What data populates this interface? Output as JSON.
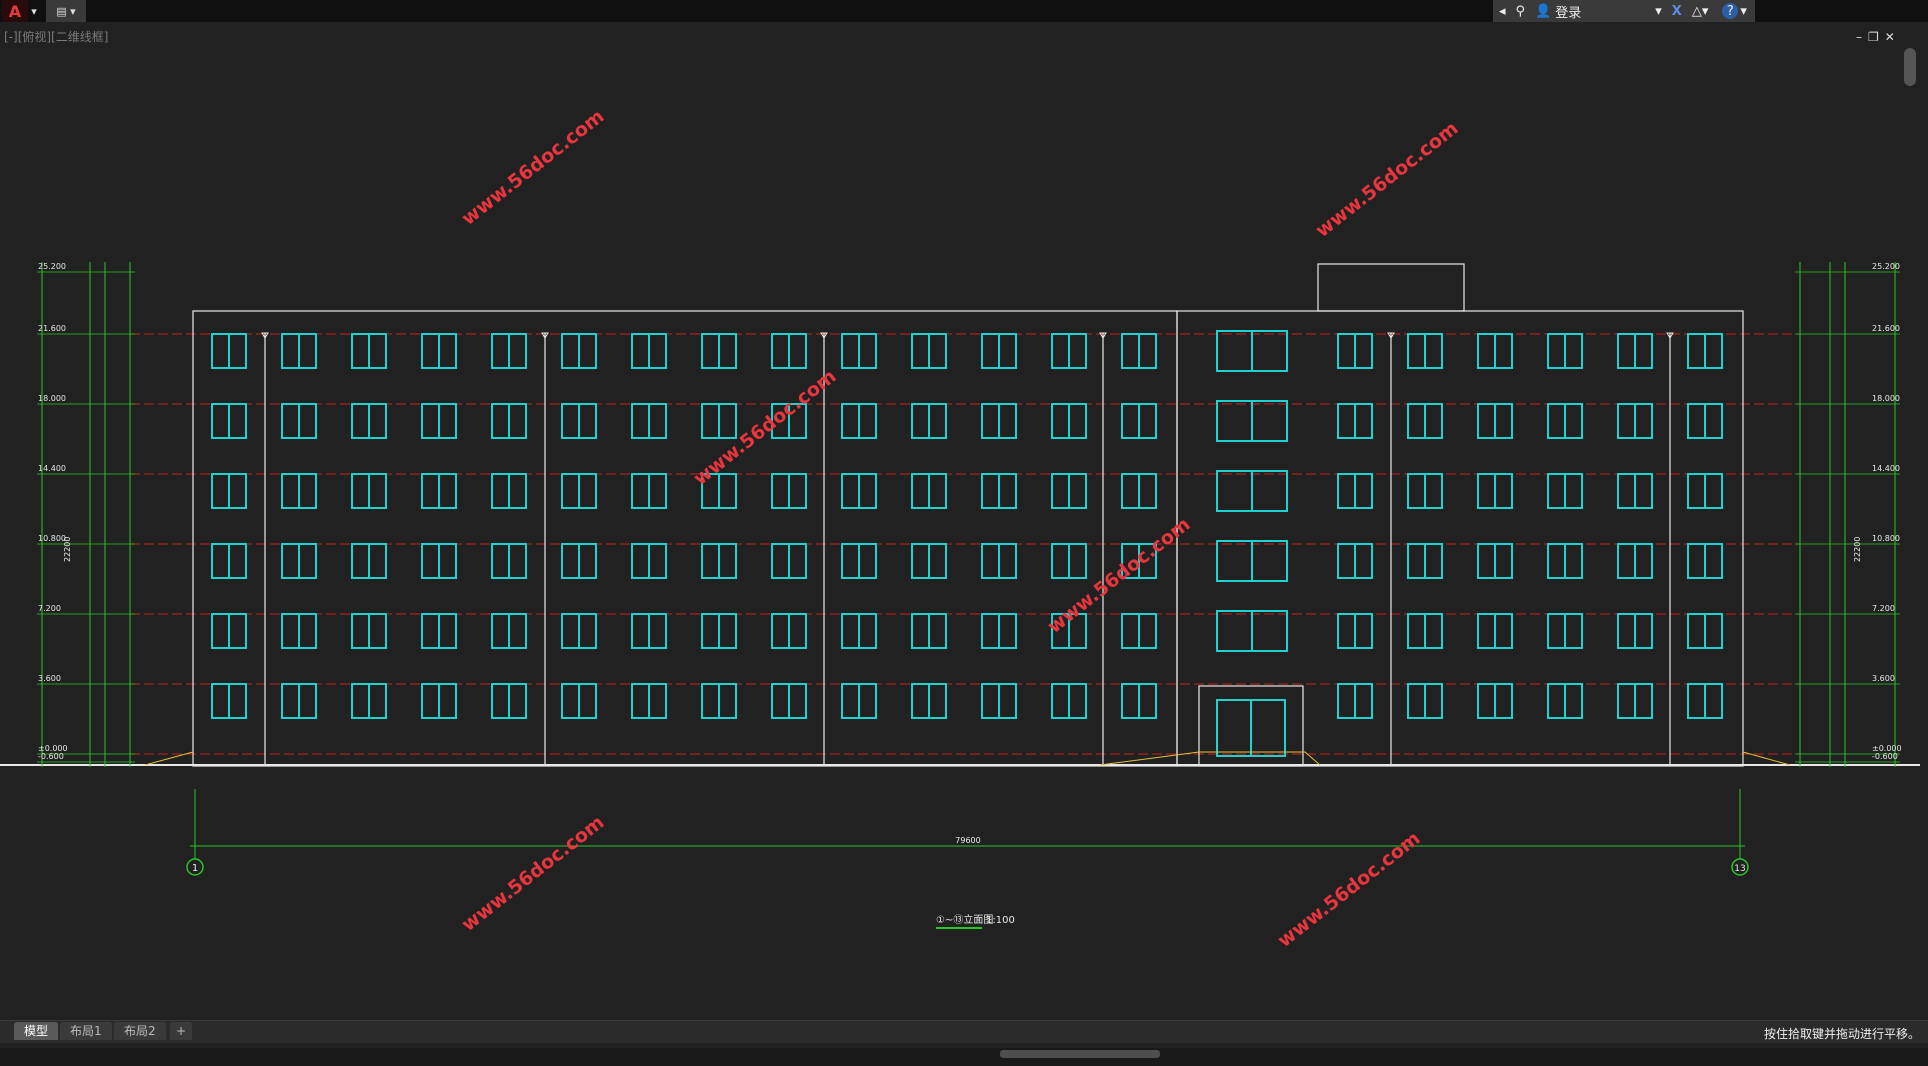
{
  "app": {
    "logo_letter": "A",
    "search_user_label": "登录"
  },
  "viewport_label": "[-][俯视][二维线框]",
  "window_controls": [
    "–",
    "❐",
    "✕"
  ],
  "drawing": {
    "elevation_labels_left": [
      "25.200",
      "21.600",
      "18.000",
      "14.400",
      "10.800",
      "7.200",
      "3.600",
      "±0.000",
      "-0.600"
    ],
    "elevation_labels_right": [
      "25.200",
      "21.600",
      "18.000",
      "14.400",
      "10.800",
      "7.200",
      "3.600",
      "±0.000",
      "-0.600"
    ],
    "dim_total_height": "22200",
    "overall_length": "79600",
    "axis_start": "1",
    "axis_end": "13",
    "caption_title": "①~⑬立面图",
    "caption_scale": "1:100",
    "watermark": "www.56doc.com",
    "colors": {
      "window": "#1fd2d2",
      "level_line": "#cc1f1f",
      "dimension": "#27c727",
      "outline": "#e8e8e8",
      "watermark": "#e8353e"
    }
  },
  "tabs": [
    "模型",
    "布局1",
    "布局2",
    "+"
  ],
  "status_text": "按住拾取键并拖动进行平移。"
}
